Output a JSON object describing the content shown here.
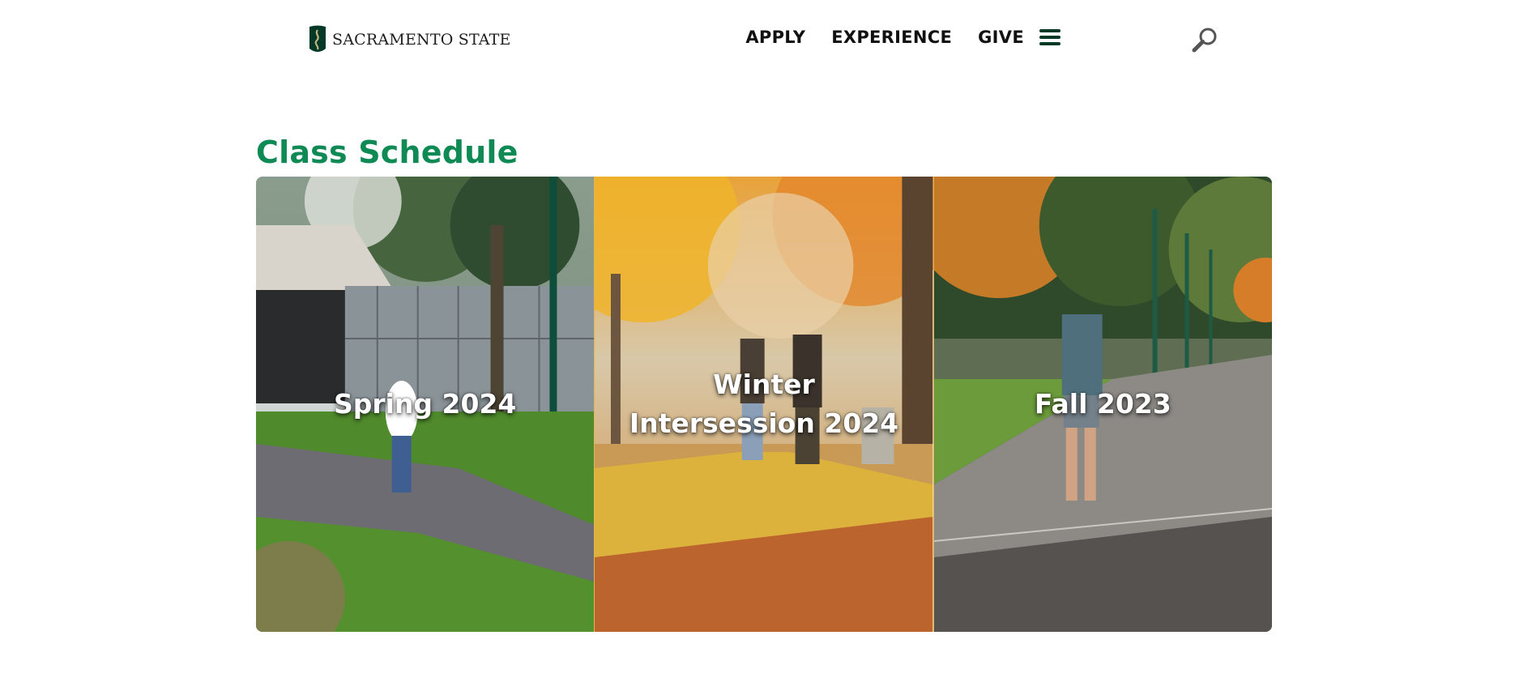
{
  "header": {
    "logo_text": "SACRAMENTO STATE",
    "nav": [
      {
        "label": "APPLY"
      },
      {
        "label": "EXPERIENCE"
      },
      {
        "label": "GIVE"
      }
    ],
    "menu_icon": "hamburger-menu-icon",
    "search_icon": "search-icon"
  },
  "main": {
    "title": "Class Schedule",
    "cards": [
      {
        "label": "Spring 2024"
      },
      {
        "label": "Winter Intersession 2024"
      },
      {
        "label": "Fall 2023"
      }
    ]
  },
  "colors": {
    "brand_green": "#043927",
    "title_green": "#0f8a55",
    "gold": "#c4b581"
  }
}
